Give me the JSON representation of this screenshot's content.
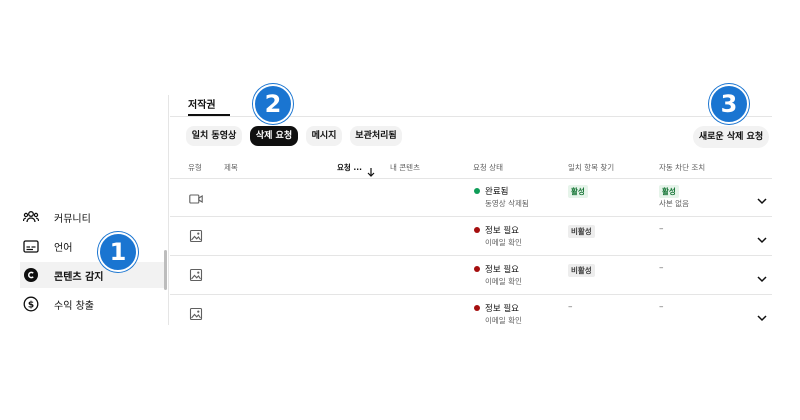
{
  "sidebar": {
    "items": [
      {
        "label": "커뮤니티",
        "icon": "community-icon"
      },
      {
        "label": "언어",
        "icon": "subtitles-icon"
      },
      {
        "label": "콘텐츠 감지",
        "icon": "copyright-icon",
        "active": true
      },
      {
        "label": "수익 창출",
        "icon": "dollar-icon"
      }
    ]
  },
  "tabs": [
    {
      "label": "저작권",
      "active": true
    }
  ],
  "chips": [
    {
      "label": "일치 동영상"
    },
    {
      "label": "삭제 요청",
      "selected": true
    },
    {
      "label": "메시지"
    },
    {
      "label": "보관처리됨"
    }
  ],
  "new_request_button": "새로운 삭제 요청",
  "table": {
    "headers": {
      "type": "유형",
      "title": "제목",
      "requested": "요청 ...",
      "my_content": "내 콘텐츠",
      "request_status": "요청 상태",
      "match_find": "일치 항목 찾기",
      "auto_block": "자동 차단 조치"
    },
    "rows": [
      {
        "type_icon": "video-icon",
        "status": "완료됨",
        "status_sub": "동영상 삭제됨",
        "status_color": "#0f9d58",
        "match": "활성",
        "match_state": "on",
        "block": "활성",
        "block_state": "on",
        "block_sub": "사본 없음"
      },
      {
        "type_icon": "image-icon",
        "status": "정보 필요",
        "status_sub": "이메일 확인",
        "status_color": "#a50e0e",
        "match": "비활성",
        "match_state": "off",
        "block": "–"
      },
      {
        "type_icon": "image-icon",
        "status": "정보 필요",
        "status_sub": "이메일 확인",
        "status_color": "#a50e0e",
        "match": "비활성",
        "match_state": "off",
        "block": "–"
      },
      {
        "type_icon": "image-icon",
        "status": "정보 필요",
        "status_sub": "이메일 확인",
        "status_color": "#a50e0e",
        "match": "–",
        "block": "–"
      }
    ]
  },
  "callouts": [
    "1",
    "2",
    "3"
  ]
}
